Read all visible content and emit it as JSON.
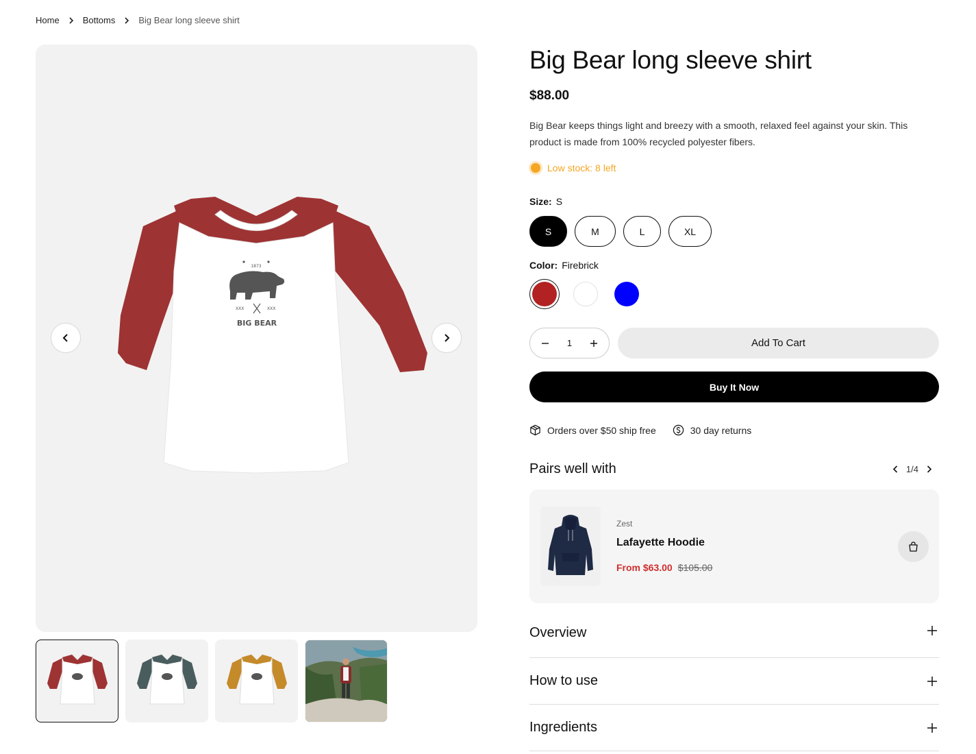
{
  "breadcrumb": {
    "home": "Home",
    "category": "Bottoms",
    "current": "Big Bear long sleeve shirt"
  },
  "product": {
    "title": "Big Bear long sleeve shirt",
    "price": "$88.00",
    "description": "Big Bear keeps things light and breezy with a smooth, relaxed feel against your skin. This product is made from 100% recycled polyester fibers.",
    "stock_text": "Low stock: 8 left",
    "stock_color": "#f5a623",
    "graphic_text": "BIG BEAR",
    "graphic_year": "1873",
    "graphic_marks": "XXX"
  },
  "size": {
    "label": "Size:",
    "selected": "S",
    "options": [
      "S",
      "M",
      "L",
      "XL"
    ]
  },
  "color": {
    "label": "Color:",
    "selected": "Firebrick",
    "swatches": [
      "#b22222",
      "#ffffff",
      "#0000ff"
    ]
  },
  "quantity": {
    "value": "1"
  },
  "buttons": {
    "add_to_cart": "Add To Cart",
    "buy_now": "Buy It Now"
  },
  "perks": {
    "shipping": "Orders over $50 ship free",
    "returns": "30 day returns"
  },
  "pairs": {
    "title": "Pairs well with",
    "pager": "1/4",
    "item": {
      "vendor": "Zest",
      "name": "Lafayette Hoodie",
      "sale_price": "From $63.00",
      "original_price": "$105.00"
    }
  },
  "accordion": [
    "Overview",
    "How to use",
    "Ingredients"
  ],
  "thumbnails": [
    {
      "name": "Firebrick",
      "sleeve_color": "#9e3333"
    },
    {
      "name": "Slate",
      "sleeve_color": "#4a5d5e"
    },
    {
      "name": "Mustard",
      "sleeve_color": "#c58a2a"
    },
    {
      "name": "Lifestyle photo"
    }
  ]
}
